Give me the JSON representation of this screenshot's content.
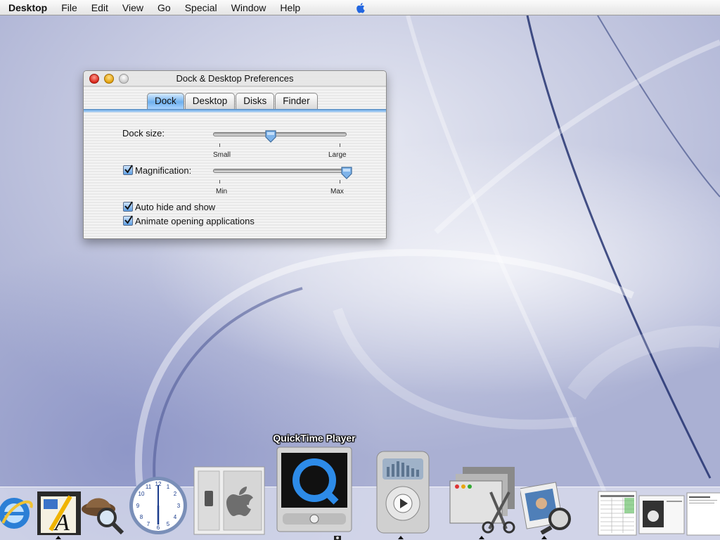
{
  "menubar": {
    "app_name": "Desktop",
    "items": [
      "File",
      "Edit",
      "View",
      "Go",
      "Special",
      "Window",
      "Help"
    ],
    "apple_icon": "apple-menu-icon"
  },
  "window": {
    "title": "Dock & Desktop Preferences",
    "tabs": [
      {
        "label": "Dock",
        "selected": true
      },
      {
        "label": "Desktop",
        "selected": false
      },
      {
        "label": "Disks",
        "selected": false
      },
      {
        "label": "Finder",
        "selected": false
      }
    ],
    "dock_size": {
      "label": "Dock size:",
      "min_label": "Small",
      "max_label": "Large",
      "value": 0.43
    },
    "magnification": {
      "label": "Magnification:",
      "checked": true,
      "min_label": "Min",
      "max_label": "Max",
      "value": 1.0
    },
    "auto_hide": {
      "label": "Auto hide and show",
      "checked": true
    },
    "animate": {
      "label": "Animate opening applications",
      "checked": true
    }
  },
  "dock": {
    "hover_label": "QuickTime Player",
    "items": [
      {
        "icon": "internet-explorer-icon",
        "running": false
      },
      {
        "icon": "textedit-icon",
        "running": true
      },
      {
        "icon": "sherlock-icon",
        "running": false
      },
      {
        "icon": "clock-icon",
        "running": false
      },
      {
        "icon": "system-preferences-icon",
        "running": false
      },
      {
        "icon": "quicktime-player-icon",
        "running": true
      },
      {
        "icon": "itunes-icon",
        "running": true
      },
      {
        "icon": "grab-icon",
        "running": true
      },
      {
        "icon": "preview-icon",
        "running": true
      },
      {
        "icon": "minimized-window-spreadsheet-icon",
        "running": false
      },
      {
        "icon": "minimized-window-image-icon",
        "running": false
      },
      {
        "icon": "minimized-window-document-icon",
        "running": false
      }
    ]
  },
  "colors": {
    "tab_selected": "#6fb0ee",
    "checkbox": "#5d9fe4",
    "close": "#d8261a",
    "minimize": "#e2a10d"
  }
}
